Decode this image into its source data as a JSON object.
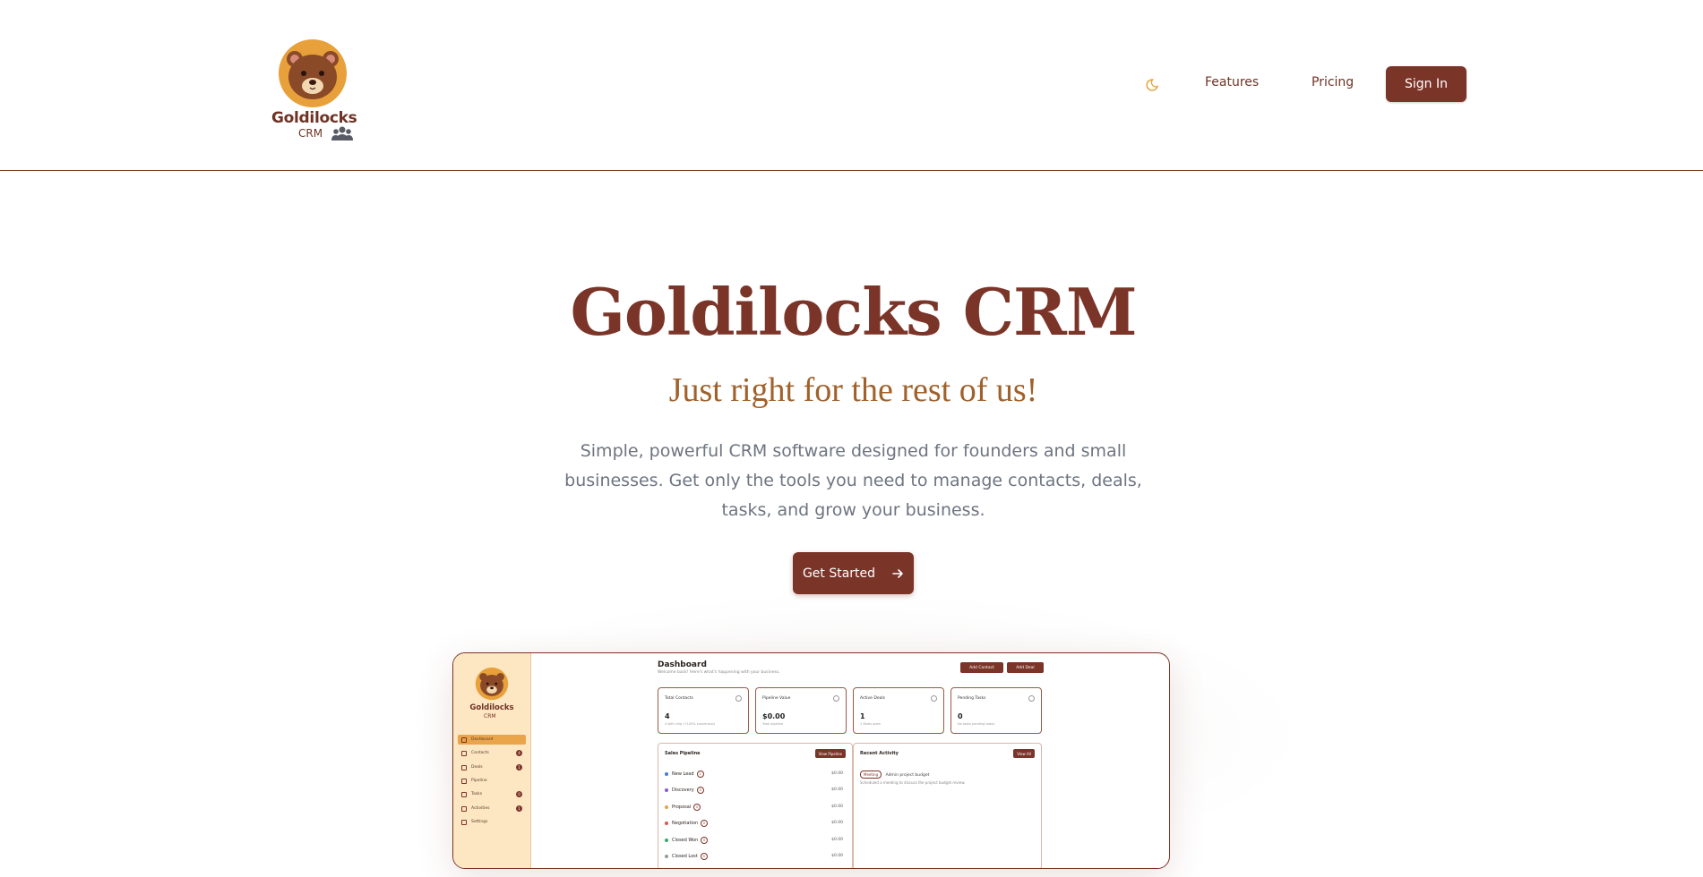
{
  "brand": {
    "name": "Goldilocks",
    "sub": "CRM"
  },
  "nav": {
    "theme_icon": "moon-icon",
    "features": "Features",
    "pricing": "Pricing",
    "signin": "Sign In"
  },
  "hero": {
    "title": "Goldilocks CRM",
    "tagline": "Just right for the rest of us!",
    "description": "Simple, powerful CRM software designed for founders and small businesses. Get only the tools you need to manage contacts, deals, tasks, and grow your business.",
    "cta": "Get Started",
    "cta_icon": "arrow-right-icon"
  },
  "preview": {
    "brand": "Goldilocks",
    "brand_sub": "CRM",
    "sidebar": [
      {
        "label": "Dashboard",
        "active": true,
        "count": ""
      },
      {
        "label": "Contacts",
        "active": false,
        "count": "4"
      },
      {
        "label": "Deals",
        "active": false,
        "count": "1"
      },
      {
        "label": "Pipeline",
        "active": false,
        "count": ""
      },
      {
        "label": "Tasks",
        "active": false,
        "count": "0"
      },
      {
        "label": "Activities",
        "active": false,
        "count": "1"
      },
      {
        "label": "Settings",
        "active": false,
        "count": ""
      }
    ],
    "title": "Dashboard",
    "subtitle": "Welcome back! Here's what's happening with your business.",
    "add_contact": "Add Contact",
    "add_deal": "Add Deal",
    "cards": [
      {
        "label": "Total Contacts",
        "value": "4",
        "note": "4 with chip (+100% conversion)"
      },
      {
        "label": "Pipeline Value",
        "value": "$0.00",
        "note": "Total pipeline"
      },
      {
        "label": "Active Deals",
        "value": "1",
        "note": "1 Deals open"
      },
      {
        "label": "Pending Tasks",
        "value": "0",
        "note": "No tasks pending today"
      }
    ],
    "pipeline": {
      "title": "Sales Pipeline",
      "button": "View Pipeline",
      "stages": [
        {
          "name": "New Lead",
          "count": "1",
          "amount": "$0.00",
          "color": "#4a7bd8"
        },
        {
          "name": "Discovery",
          "count": "0",
          "amount": "$0.00",
          "color": "#8a5ad8"
        },
        {
          "name": "Proposal",
          "count": "0",
          "amount": "$0.00",
          "color": "#e8a43a"
        },
        {
          "name": "Negotiation",
          "count": "0",
          "amount": "$0.00",
          "color": "#e0564a"
        },
        {
          "name": "Closed Won",
          "count": "0",
          "amount": "$0.00",
          "color": "#3aa86a"
        },
        {
          "name": "Closed Lost",
          "count": "0",
          "amount": "$0.00",
          "color": "#999999"
        }
      ]
    },
    "activity": {
      "title": "Recent Activity",
      "button": "View All",
      "tag": "Meeting",
      "heading": "Admin project budget",
      "text": "Scheduled a meeting to discuss the project budget review."
    }
  },
  "colors": {
    "brand": "#7b3428",
    "accent": "#a0612a",
    "sidebar": "#fde6c2"
  }
}
